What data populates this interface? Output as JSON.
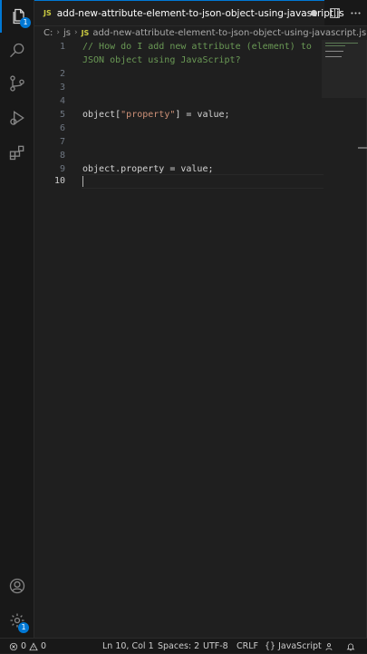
{
  "activity_bar": {
    "explorer_badge": "1",
    "settings_badge": "1"
  },
  "tab": {
    "file_badge": "JS",
    "title": "add-new-attribute-element-to-json-object-using-javascript.js"
  },
  "breadcrumb": {
    "drive": "C:",
    "folder": "js",
    "file_badge": "JS",
    "file": "add-new-attribute-element-to-json-object-using-javascript.js"
  },
  "editor": {
    "line_numbers": [
      "1",
      "2",
      "3",
      "4",
      "5",
      "6",
      "7",
      "8",
      "9",
      "10"
    ],
    "comment_line1": "// How do I add new attribute (element) to",
    "comment_line2": "JSON object using JavaScript?",
    "line5_before": "object[",
    "line5_string": "\"property\"",
    "line5_after": "] = value;",
    "line9": "object.property = value;"
  },
  "status_bar": {
    "errors": "0",
    "warnings": "0",
    "position": "Ln 10, Col 1",
    "spaces": "Spaces: 2",
    "encoding": "UTF-8",
    "eol": "CRLF",
    "language": "JavaScript",
    "language_prefix": "{}"
  }
}
